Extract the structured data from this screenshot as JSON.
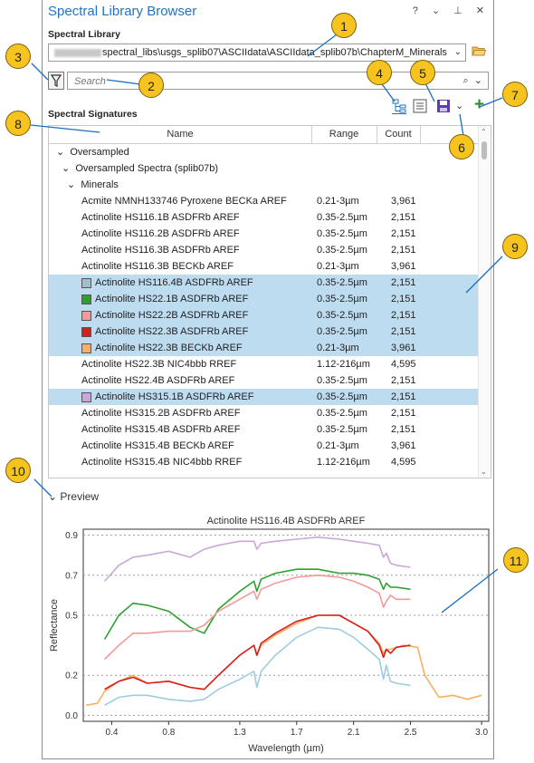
{
  "pane": {
    "title": "Spectral Library Browser",
    "window_controls": "? ⌄ ⊥ ✕"
  },
  "library": {
    "label": "Spectral Library",
    "path": "spectral_libs\\usgs_splib07\\ASCIIdata\\ASCIIdata_splib07b\\ChapterM_Minerals"
  },
  "search": {
    "placeholder": "Search"
  },
  "signatures": {
    "label": "Spectral Signatures",
    "columns": [
      "Name",
      "Range",
      "Count"
    ],
    "tree": [
      {
        "label": "Oversampled",
        "level": 0
      },
      {
        "label": "Oversampled Spectra (splib07b)",
        "level": 1
      },
      {
        "label": "Minerals",
        "level": 2
      }
    ],
    "rows": [
      {
        "name": "Acmite NMNH133746 Pyroxene BECKa AREF",
        "range": "0.21-3µm",
        "count": "3,961",
        "selected": false,
        "swatch": ""
      },
      {
        "name": "Actinolite HS116.1B ASDFRb AREF",
        "range": "0.35-2.5µm",
        "count": "2,151",
        "selected": false,
        "swatch": ""
      },
      {
        "name": "Actinolite HS116.2B ASDFRb AREF",
        "range": "0.35-2.5µm",
        "count": "2,151",
        "selected": false,
        "swatch": ""
      },
      {
        "name": "Actinolite HS116.3B ASDFRb AREF",
        "range": "0.35-2.5µm",
        "count": "2,151",
        "selected": false,
        "swatch": ""
      },
      {
        "name": "Actinolite HS116.3B BECKb AREF",
        "range": "0.21-3µm",
        "count": "3,961",
        "selected": false,
        "swatch": ""
      },
      {
        "name": "Actinolite HS116.4B ASDFRb AREF",
        "range": "0.35-2.5µm",
        "count": "2,151",
        "selected": true,
        "swatch": "#9fbfd1"
      },
      {
        "name": "Actinolite HS22.1B ASDFRb AREF",
        "range": "0.35-2.5µm",
        "count": "2,151",
        "selected": true,
        "swatch": "#2ea02e"
      },
      {
        "name": "Actinolite HS22.2B ASDFRb AREF",
        "range": "0.35-2.5µm",
        "count": "2,151",
        "selected": true,
        "swatch": "#f29a9a"
      },
      {
        "name": "Actinolite HS22.3B ASDFRb AREF",
        "range": "0.35-2.5µm",
        "count": "2,151",
        "selected": true,
        "swatch": "#d81e1e"
      },
      {
        "name": "Actinolite HS22.3B BECKb AREF",
        "range": "0.21-3µm",
        "count": "3,961",
        "selected": true,
        "swatch": "#f6b063"
      },
      {
        "name": "Actinolite HS22.3B NIC4bbb RREF",
        "range": "1.12-216µm",
        "count": "4,595",
        "selected": false,
        "swatch": ""
      },
      {
        "name": "Actinolite HS22.4B ASDFRb AREF",
        "range": "0.35-2.5µm",
        "count": "2,151",
        "selected": false,
        "swatch": ""
      },
      {
        "name": "Actinolite HS315.1B ASDFRb AREF",
        "range": "0.35-2.5µm",
        "count": "2,151",
        "selected": true,
        "swatch": "#c9a7d8"
      },
      {
        "name": "Actinolite HS315.2B ASDFRb AREF",
        "range": "0.35-2.5µm",
        "count": "2,151",
        "selected": false,
        "swatch": ""
      },
      {
        "name": "Actinolite HS315.4B ASDFRb AREF",
        "range": "0.35-2.5µm",
        "count": "2,151",
        "selected": false,
        "swatch": ""
      },
      {
        "name": "Actinolite HS315.4B BECKb AREF",
        "range": "0.21-3µm",
        "count": "3,961",
        "selected": false,
        "swatch": ""
      },
      {
        "name": "Actinolite HS315.4B NIC4bbb RREF",
        "range": "1.12-216µm",
        "count": "4,595",
        "selected": false,
        "swatch": ""
      }
    ]
  },
  "preview": {
    "label": "Preview"
  },
  "chart_data": {
    "type": "line",
    "title": "Actinolite HS116.4B ASDFRb AREF",
    "xlabel": "Wavelength (µm)",
    "ylabel": "Reflectance",
    "xlim": [
      0.2,
      3.05
    ],
    "ylim": [
      -0.03,
      0.93
    ],
    "xticks": [
      0.4,
      0.8,
      1.3,
      1.7,
      2.1,
      2.5,
      3.0
    ],
    "xtick_labels": [
      "0.4",
      "0.8",
      "1.3",
      "1.7",
      "2.1",
      "2.5",
      "3.0"
    ],
    "yticks": [
      0.0,
      0.2,
      0.5,
      0.7,
      0.9
    ],
    "ytick_labels": [
      "0.0",
      "0.2",
      "0.5",
      "0.7",
      "0.9"
    ],
    "grid": "horizontal dashed",
    "series": [
      {
        "color": "#c9a7d8",
        "x": [
          0.35,
          0.45,
          0.55,
          0.65,
          0.8,
          0.95,
          1.05,
          1.15,
          1.3,
          1.4,
          1.42,
          1.45,
          1.55,
          1.7,
          1.85,
          2.0,
          2.1,
          2.2,
          2.28,
          2.31,
          2.33,
          2.36,
          2.4,
          2.5
        ],
        "y": [
          0.67,
          0.75,
          0.79,
          0.8,
          0.82,
          0.79,
          0.83,
          0.85,
          0.87,
          0.87,
          0.83,
          0.86,
          0.87,
          0.88,
          0.89,
          0.88,
          0.87,
          0.86,
          0.85,
          0.79,
          0.81,
          0.76,
          0.75,
          0.74
        ]
      },
      {
        "color": "#2ea02e",
        "x": [
          0.35,
          0.45,
          0.55,
          0.65,
          0.8,
          0.95,
          1.05,
          1.15,
          1.3,
          1.4,
          1.42,
          1.45,
          1.55,
          1.7,
          1.85,
          2.0,
          2.1,
          2.2,
          2.28,
          2.31,
          2.33,
          2.36,
          2.4,
          2.5
        ],
        "y": [
          0.38,
          0.5,
          0.56,
          0.55,
          0.52,
          0.44,
          0.41,
          0.53,
          0.62,
          0.67,
          0.62,
          0.68,
          0.71,
          0.73,
          0.73,
          0.71,
          0.71,
          0.7,
          0.68,
          0.63,
          0.66,
          0.64,
          0.64,
          0.63
        ]
      },
      {
        "color": "#f29a9a",
        "x": [
          0.35,
          0.45,
          0.55,
          0.65,
          0.8,
          0.95,
          1.05,
          1.15,
          1.3,
          1.4,
          1.42,
          1.45,
          1.55,
          1.7,
          1.85,
          2.0,
          2.1,
          2.2,
          2.28,
          2.31,
          2.33,
          2.36,
          2.4,
          2.5
        ],
        "y": [
          0.28,
          0.35,
          0.41,
          0.41,
          0.42,
          0.42,
          0.45,
          0.52,
          0.58,
          0.62,
          0.58,
          0.63,
          0.66,
          0.69,
          0.7,
          0.69,
          0.67,
          0.64,
          0.61,
          0.54,
          0.57,
          0.6,
          0.58,
          0.58
        ]
      },
      {
        "color": "#f6b063",
        "x": [
          0.22,
          0.3,
          0.35,
          0.45,
          0.55,
          0.65,
          0.8,
          0.95,
          1.05,
          1.15,
          1.3,
          1.4,
          1.42,
          1.45,
          1.55,
          1.7,
          1.85,
          2.0,
          2.1,
          2.2,
          2.28,
          2.31,
          2.33,
          2.36,
          2.45,
          2.55,
          2.6,
          2.7,
          2.8,
          2.9,
          3.0
        ],
        "y": [
          0.05,
          0.06,
          0.12,
          0.17,
          0.2,
          0.16,
          0.17,
          0.14,
          0.13,
          0.2,
          0.3,
          0.35,
          0.3,
          0.35,
          0.4,
          0.46,
          0.5,
          0.5,
          0.46,
          0.42,
          0.36,
          0.31,
          0.33,
          0.33,
          0.35,
          0.34,
          0.2,
          0.09,
          0.1,
          0.08,
          0.1
        ]
      },
      {
        "color": "#d81e1e",
        "x": [
          0.35,
          0.45,
          0.55,
          0.65,
          0.8,
          0.95,
          1.05,
          1.15,
          1.3,
          1.4,
          1.42,
          1.45,
          1.55,
          1.7,
          1.85,
          2.0,
          2.1,
          2.2,
          2.28,
          2.31,
          2.33,
          2.36,
          2.4,
          2.5
        ],
        "y": [
          0.13,
          0.17,
          0.19,
          0.16,
          0.17,
          0.14,
          0.13,
          0.2,
          0.3,
          0.35,
          0.3,
          0.36,
          0.41,
          0.47,
          0.5,
          0.5,
          0.46,
          0.42,
          0.35,
          0.29,
          0.33,
          0.31,
          0.34,
          0.35
        ]
      },
      {
        "color": "#9fcde0",
        "x": [
          0.35,
          0.45,
          0.55,
          0.65,
          0.8,
          0.95,
          1.05,
          1.15,
          1.3,
          1.4,
          1.42,
          1.45,
          1.55,
          1.7,
          1.85,
          2.0,
          2.1,
          2.2,
          2.28,
          2.31,
          2.33,
          2.36,
          2.4,
          2.5
        ],
        "y": [
          0.05,
          0.09,
          0.1,
          0.1,
          0.08,
          0.07,
          0.08,
          0.13,
          0.18,
          0.22,
          0.14,
          0.22,
          0.3,
          0.39,
          0.44,
          0.43,
          0.39,
          0.33,
          0.28,
          0.18,
          0.25,
          0.17,
          0.16,
          0.15
        ]
      }
    ]
  },
  "callouts": [
    "1",
    "2",
    "3",
    "4",
    "5",
    "6",
    "7",
    "8",
    "9",
    "10",
    "11"
  ],
  "colors": {
    "accent": "#1e74c6",
    "selection": "#bedcf0",
    "callout": "#f7c31e"
  }
}
